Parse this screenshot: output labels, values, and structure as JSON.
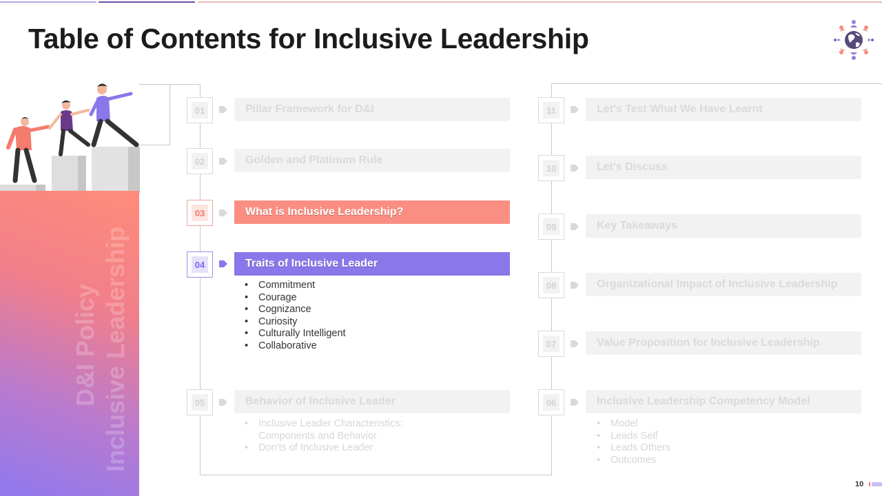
{
  "title": "Table of Contents for Inclusive Leadership",
  "side_panel": {
    "line1": "D&I Policy",
    "line2": "Inclusive Leadership"
  },
  "left_items": [
    {
      "num": "01",
      "label": "Pillar Framework for D&I"
    },
    {
      "num": "02",
      "label": "Golden and Platinum Rule"
    },
    {
      "num": "03",
      "label": "What is Inclusive Leadership?"
    },
    {
      "num": "04",
      "label": "Traits of Inclusive Leader"
    },
    {
      "num": "05",
      "label": "Behavior of Inclusive Leader"
    }
  ],
  "right_items": [
    {
      "num": "11",
      "label": "Let's Test What We Have Learnt"
    },
    {
      "num": "10",
      "label": "Let's Discuss"
    },
    {
      "num": "09",
      "label": "Key Takeaways"
    },
    {
      "num": "08",
      "label": "Organizational Impact of Inclusive Leadership"
    },
    {
      "num": "07",
      "label": "Value Proposition for Inclusive Leadership"
    },
    {
      "num": "06",
      "label": "Inclusive Leadership Competency Model"
    }
  ],
  "traits_bullets": [
    "Commitment",
    "Courage",
    "Cognizance",
    "Curiosity",
    "Culturally Intelligent",
    "Collaborative"
  ],
  "behavior_bullets": [
    "Inclusive Leader Characteristics:",
    "Components and Behavior",
    "Don'ts of Inclusive Leader"
  ],
  "competency_bullets": [
    "Model",
    "Leads Self",
    "Leads Others",
    "Outcomes"
  ],
  "page_number": "10",
  "colors": {
    "accent_red": "#fb8e83",
    "accent_purple": "#8a78ea",
    "inactive_bar": "#f2f2f2"
  }
}
